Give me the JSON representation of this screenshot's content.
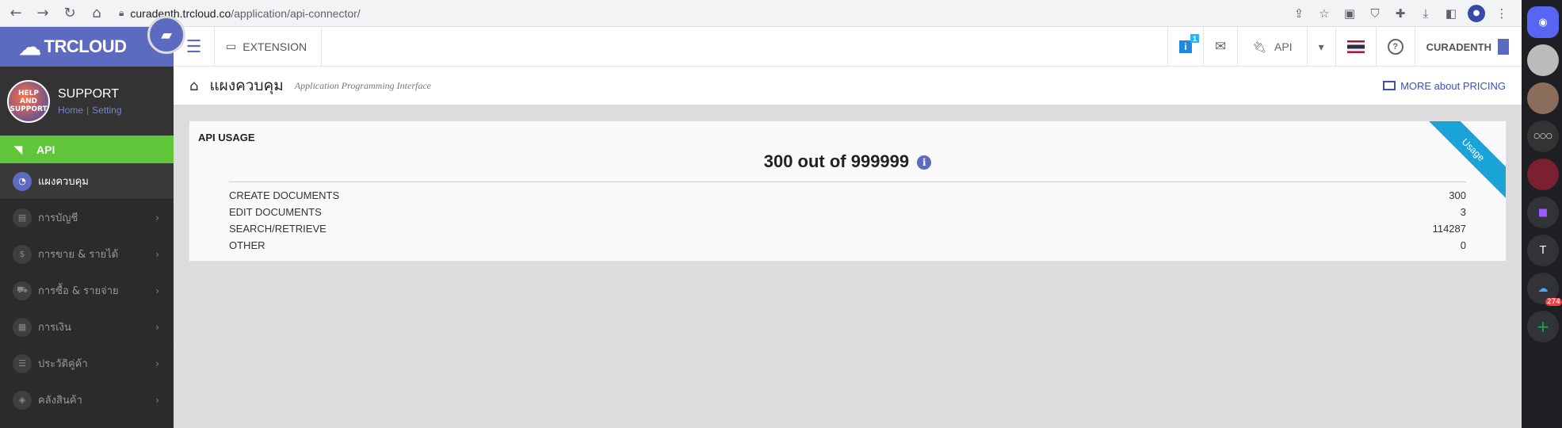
{
  "browser": {
    "url_host": "curadenth.trcloud.co",
    "url_path": "/application/api-connector/"
  },
  "header": {
    "brand": "TRCLOUD",
    "extension_label": "EXTENSION",
    "info_count": "1",
    "api_label": "API",
    "company": "CURADENTH"
  },
  "sidebar": {
    "profile_name": "SUPPORT",
    "profile_home": "Home",
    "profile_sep": "|",
    "profile_setting": "Setting",
    "avatar_text": "HELP AND SUPPORT",
    "api_label": "API",
    "items": [
      {
        "label": "แผงควบคุม"
      },
      {
        "label": "การบัญชี"
      },
      {
        "label": "การขาย & รายได้"
      },
      {
        "label": "การซื้อ & รายจ่าย"
      },
      {
        "label": "การเงิน"
      },
      {
        "label": "ประวัติคู่ค้า"
      },
      {
        "label": "คลังสินค้า"
      }
    ]
  },
  "page": {
    "title": "แผงควบคุม",
    "subtitle": "Application Programming Interface",
    "pricing_link": "MORE about PRICING"
  },
  "usage": {
    "title": "API USAGE",
    "summary": "300 out of 999999",
    "ribbon": "Usage",
    "rows": [
      {
        "label": "CREATE DOCUMENTS",
        "value": "300"
      },
      {
        "label": "EDIT DOCUMENTS",
        "value": "3"
      },
      {
        "label": "SEARCH/RETRIEVE",
        "value": "114287"
      },
      {
        "label": "OTHER",
        "value": "0"
      }
    ]
  },
  "discord": {
    "badge": "274"
  }
}
